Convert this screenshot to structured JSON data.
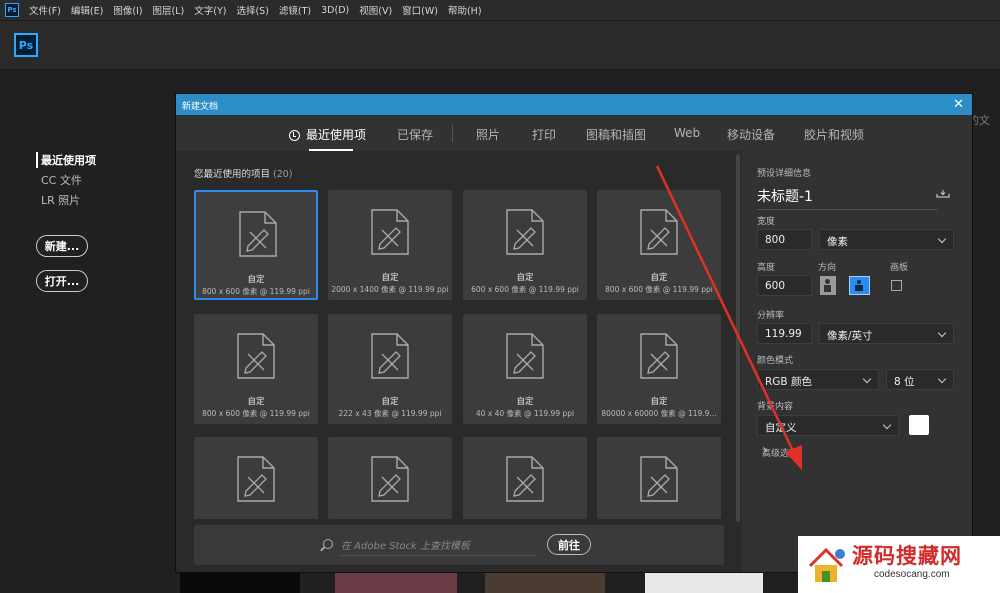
{
  "app": {
    "logo": "Ps",
    "menu": [
      "文件(F)",
      "编辑(E)",
      "图像(I)",
      "图层(L)",
      "文字(Y)",
      "选择(S)",
      "滤镜(T)",
      "3D(D)",
      "视图(V)",
      "窗口(W)",
      "帮助(H)"
    ]
  },
  "home": {
    "nav": [
      "最近使用项",
      "CC 文件",
      "LR 照片"
    ],
    "new_button": "新建...",
    "open_button": "打开...",
    "partial_text": "的文"
  },
  "dialog": {
    "title": "新建文档",
    "close": "✕",
    "tabs": [
      "最近使用项",
      "已保存",
      "照片",
      "打印",
      "图稿和插图",
      "Web",
      "移动设备",
      "胶片和视频"
    ],
    "recent_heading": "您最近使用的项目",
    "recent_count": "(20)",
    "cards": [
      {
        "name": "自定",
        "size": "800 x 600 像素 @ 119.99 ppi"
      },
      {
        "name": "自定",
        "size": "2000 x 1400 像素 @ 119.99 ppi"
      },
      {
        "name": "自定",
        "size": "600 x 600 像素 @ 119.99 ppi"
      },
      {
        "name": "自定",
        "size": "800 x 600 像素 @ 119.99 ppi"
      },
      {
        "name": "自定",
        "size": "800 x 600 像素 @ 119.99 ppi"
      },
      {
        "name": "自定",
        "size": "222 x 43 像素 @ 119.99 ppi"
      },
      {
        "name": "自定",
        "size": "40 x 40 像素 @ 119.99 ppi"
      },
      {
        "name": "自定",
        "size": "80000 x 60000 像素 @ 119.9..."
      },
      {
        "name": "",
        "size": ""
      },
      {
        "name": "",
        "size": ""
      },
      {
        "name": "",
        "size": ""
      },
      {
        "name": "",
        "size": ""
      }
    ],
    "stock_placeholder": "在 Adobe Stock 上查找模板",
    "go_button": "前往",
    "preset": {
      "heading": "预设详细信息",
      "doc_name": "未标题-1",
      "width_label": "宽度",
      "width_value": "800",
      "width_unit": "像素",
      "height_label": "高度",
      "height_value": "600",
      "orientation_label": "方向",
      "artboard_label": "画板",
      "resolution_label": "分辨率",
      "resolution_value": "119.99",
      "resolution_unit": "像素/英寸",
      "color_mode_label": "颜色模式",
      "color_mode_value": "RGB 颜色",
      "bit_depth": "8 位",
      "background_label": "背景内容",
      "background_value": "自定义",
      "background_color": "#ffffff",
      "advanced_label": "高级选项"
    }
  },
  "watermark": {
    "title": "源码搜藏网",
    "url": "codesocang.com"
  }
}
